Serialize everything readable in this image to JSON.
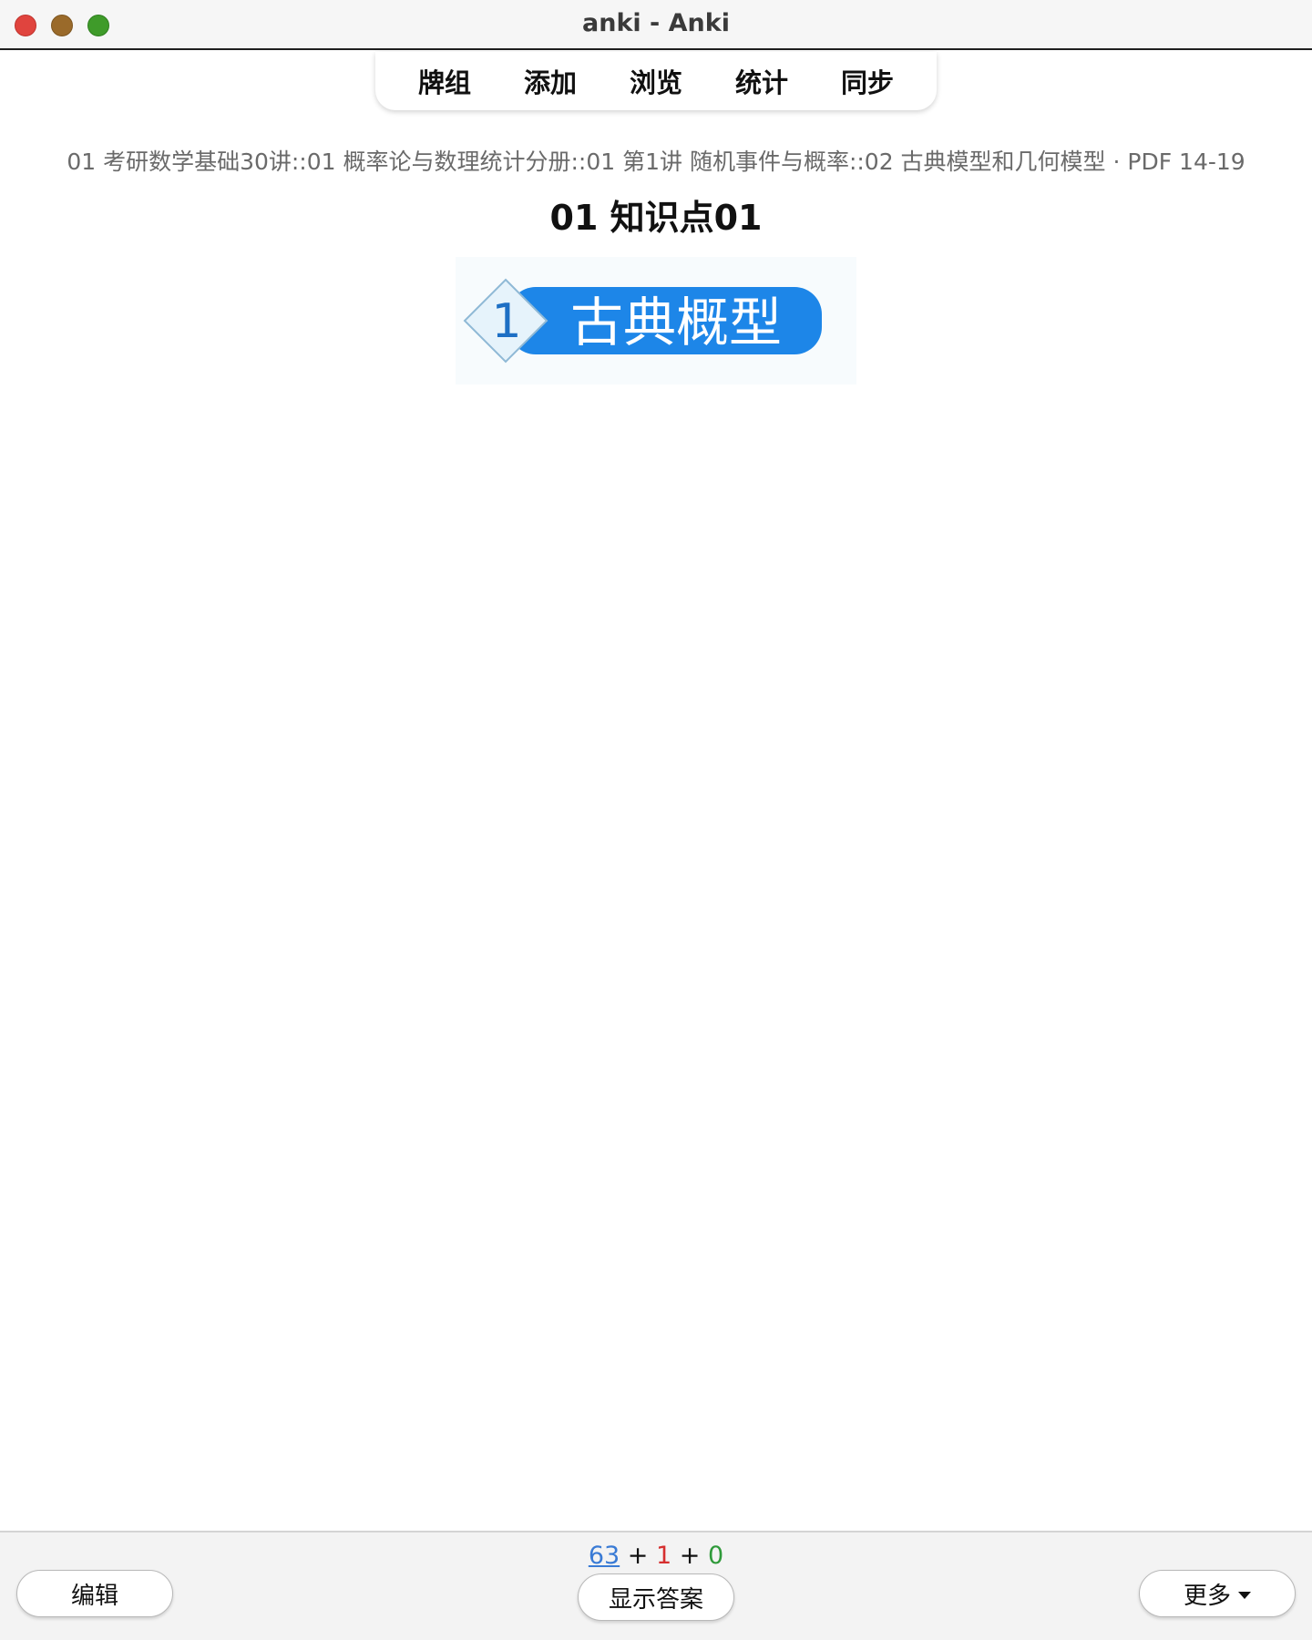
{
  "window": {
    "title": "anki - Anki"
  },
  "nav": {
    "items": [
      {
        "label": "牌组"
      },
      {
        "label": "添加"
      },
      {
        "label": "浏览"
      },
      {
        "label": "统计"
      },
      {
        "label": "同步"
      }
    ]
  },
  "card": {
    "deck_path": "01 考研数学基础30讲::01 概率论与数理统计分册::01 第1讲 随机事件与概率::02 古典模型和几何模型 · PDF 14-19",
    "title": "01 知识点01",
    "image": {
      "badge_number": "1",
      "label": "古典概型",
      "colors": {
        "banner": "#1d86e8",
        "diamond": "#e6f3fb",
        "number": "#1d6fc4",
        "text": "#ffffff"
      }
    }
  },
  "bottom": {
    "counts": {
      "new": "63",
      "learn": "1",
      "review": "0",
      "separator": "+",
      "colors": {
        "new": "#3a7bd5",
        "learn": "#d62f2f",
        "review": "#2f9a3a"
      }
    },
    "edit_label": "编辑",
    "show_answer_label": "显示答案",
    "more_label": "更多"
  }
}
